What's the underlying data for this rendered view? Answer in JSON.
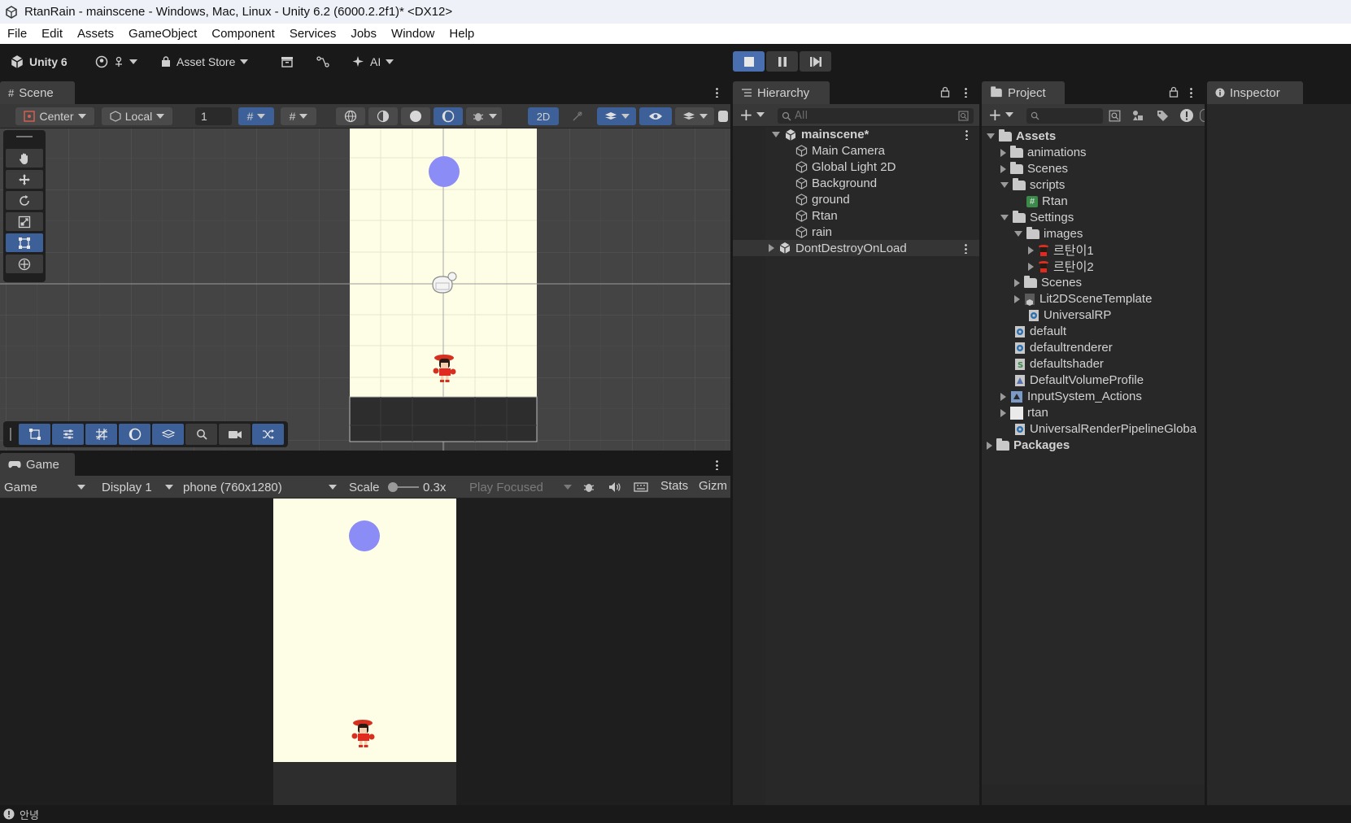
{
  "window": {
    "title": "RtanRain - mainscene - Windows, Mac, Linux - Unity 6.2 (6000.2.2f1)* <DX12>"
  },
  "menu": [
    "File",
    "Edit",
    "Assets",
    "GameObject",
    "Component",
    "Services",
    "Jobs",
    "Window",
    "Help"
  ],
  "toolbar": {
    "brand": "Unity 6",
    "asset_store": "Asset Store",
    "ai": "AI",
    "play_state": "playing"
  },
  "scene": {
    "tab": "Scene",
    "pivot": "Center",
    "space": "Local",
    "snap_value": "1",
    "mode_2d": "2D"
  },
  "game": {
    "tab": "Game",
    "view_mode": "Game",
    "display": "Display 1",
    "resolution": "phone (760x1280)",
    "scale_label": "Scale",
    "scale_value": "0.3x",
    "play_focused": "Play Focused",
    "stats": "Stats",
    "gizmos": "Gizm"
  },
  "hierarchy": {
    "tab": "Hierarchy",
    "search_placeholder": "All",
    "scene_name": "mainscene*",
    "objects": [
      "Main Camera",
      "Global Light 2D",
      "Background",
      "ground",
      "Rtan",
      "rain"
    ],
    "dont_destroy": "DontDestroyOnLoad"
  },
  "project": {
    "tab": "Project",
    "assets_root": "Assets",
    "items": {
      "animations": "animations",
      "scenes": "Scenes",
      "scripts": "scripts",
      "rtan_script": "Rtan",
      "settings": "Settings",
      "images": "images",
      "img1": "르탄이1",
      "img2": "르탄이2",
      "settings_scenes": "Scenes",
      "lit2d": "Lit2DSceneTemplate",
      "universal_rp": "UniversalRP",
      "default": "default",
      "defaultrenderer": "defaultrenderer",
      "defaultshader": "defaultshader",
      "volume_profile": "DefaultVolumeProfile",
      "input_actions": "InputSystem_Actions",
      "rtan": "rtan",
      "urp_global": "UniversalRenderPipelineGloba"
    },
    "packages": "Packages"
  },
  "inspector": {
    "tab": "Inspector"
  },
  "status": {
    "message": "안녕"
  },
  "colors": {
    "accent": "#4a6fb0",
    "game_bg": "#fefee6",
    "ball": "#8c8cf6",
    "ground": "#2d2d2d"
  }
}
